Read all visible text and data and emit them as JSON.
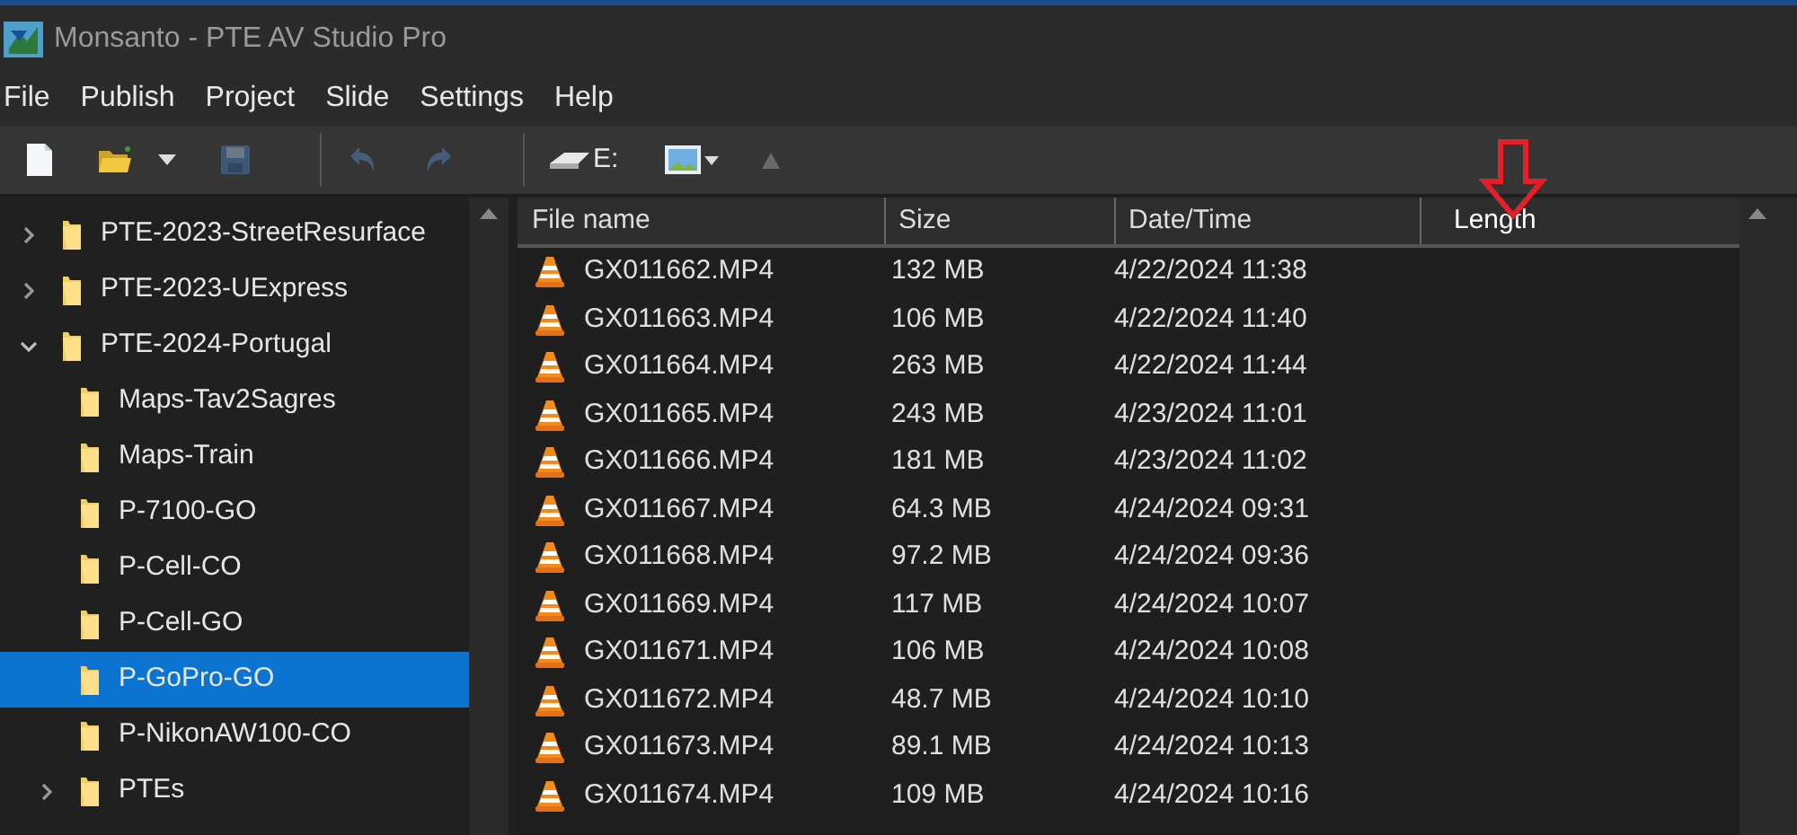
{
  "window": {
    "title": "Monsanto - PTE AV Studio Pro"
  },
  "menu": [
    "File",
    "Publish",
    "Project",
    "Slide",
    "Settings",
    "Help"
  ],
  "toolbar": [
    {
      "kind": "new",
      "disabled": false
    },
    {
      "kind": "open",
      "disabled": false
    },
    {
      "kind": "save",
      "disabled": true
    },
    {
      "kind": "separator"
    },
    {
      "kind": "undo",
      "disabled": true
    },
    {
      "kind": "redo",
      "disabled": true
    },
    {
      "kind": "separator"
    },
    {
      "kind": "drive",
      "label": "E:",
      "disabled": false
    },
    {
      "kind": "view",
      "disabled": false
    },
    {
      "kind": "up",
      "disabled": true
    }
  ],
  "tree": [
    {
      "label": "PTE-2023-StreetResurface",
      "expanded": false,
      "selected": false
    },
    {
      "label": "PTE-2023-UExpress",
      "expanded": false,
      "selected": false
    },
    {
      "label": "PTE-2024-Portugal",
      "expanded": true,
      "selected": false,
      "children": [
        {
          "label": "Maps-Tav2Sagres",
          "selected": false
        },
        {
          "label": "Maps-Train",
          "selected": false
        },
        {
          "label": "P-7100-GO",
          "selected": false
        },
        {
          "label": "P-Cell-CO",
          "selected": false
        },
        {
          "label": "P-Cell-GO",
          "selected": false
        },
        {
          "label": "P-GoPro-GO",
          "selected": true
        },
        {
          "label": "P-NikonAW100-CO",
          "selected": false
        },
        {
          "label": "PTEs",
          "expanded": false,
          "selected": false
        }
      ]
    }
  ],
  "file_list": {
    "columns": [
      "File name",
      "Size",
      "Date/Time",
      "Length"
    ],
    "rows": [
      [
        "GX011662.MP4",
        "132 MB",
        "4/22/2024 11:38"
      ],
      [
        "GX011663.MP4",
        "106 MB",
        "4/22/2024 11:40"
      ],
      [
        "GX011664.MP4",
        "263 MB",
        "4/22/2024 11:44"
      ],
      [
        "GX011665.MP4",
        "243 MB",
        "4/23/2024 11:01"
      ],
      [
        "GX011666.MP4",
        "181 MB",
        "4/23/2024 11:02"
      ],
      [
        "GX011667.MP4",
        "64.3 MB",
        "4/24/2024 09:31"
      ],
      [
        "GX011668.MP4",
        "97.2 MB",
        "4/24/2024 09:36"
      ],
      [
        "GX011669.MP4",
        "117 MB",
        "4/24/2024 10:07"
      ],
      [
        "GX011671.MP4",
        "106 MB",
        "4/24/2024 10:08"
      ],
      [
        "GX011672.MP4",
        "48.7 MB",
        "4/24/2024 10:10"
      ],
      [
        "GX011673.MP4",
        "89.1 MB",
        "4/24/2024 10:13"
      ],
      [
        "GX011674.MP4",
        "109 MB",
        "4/24/2024 10:16"
      ]
    ]
  }
}
